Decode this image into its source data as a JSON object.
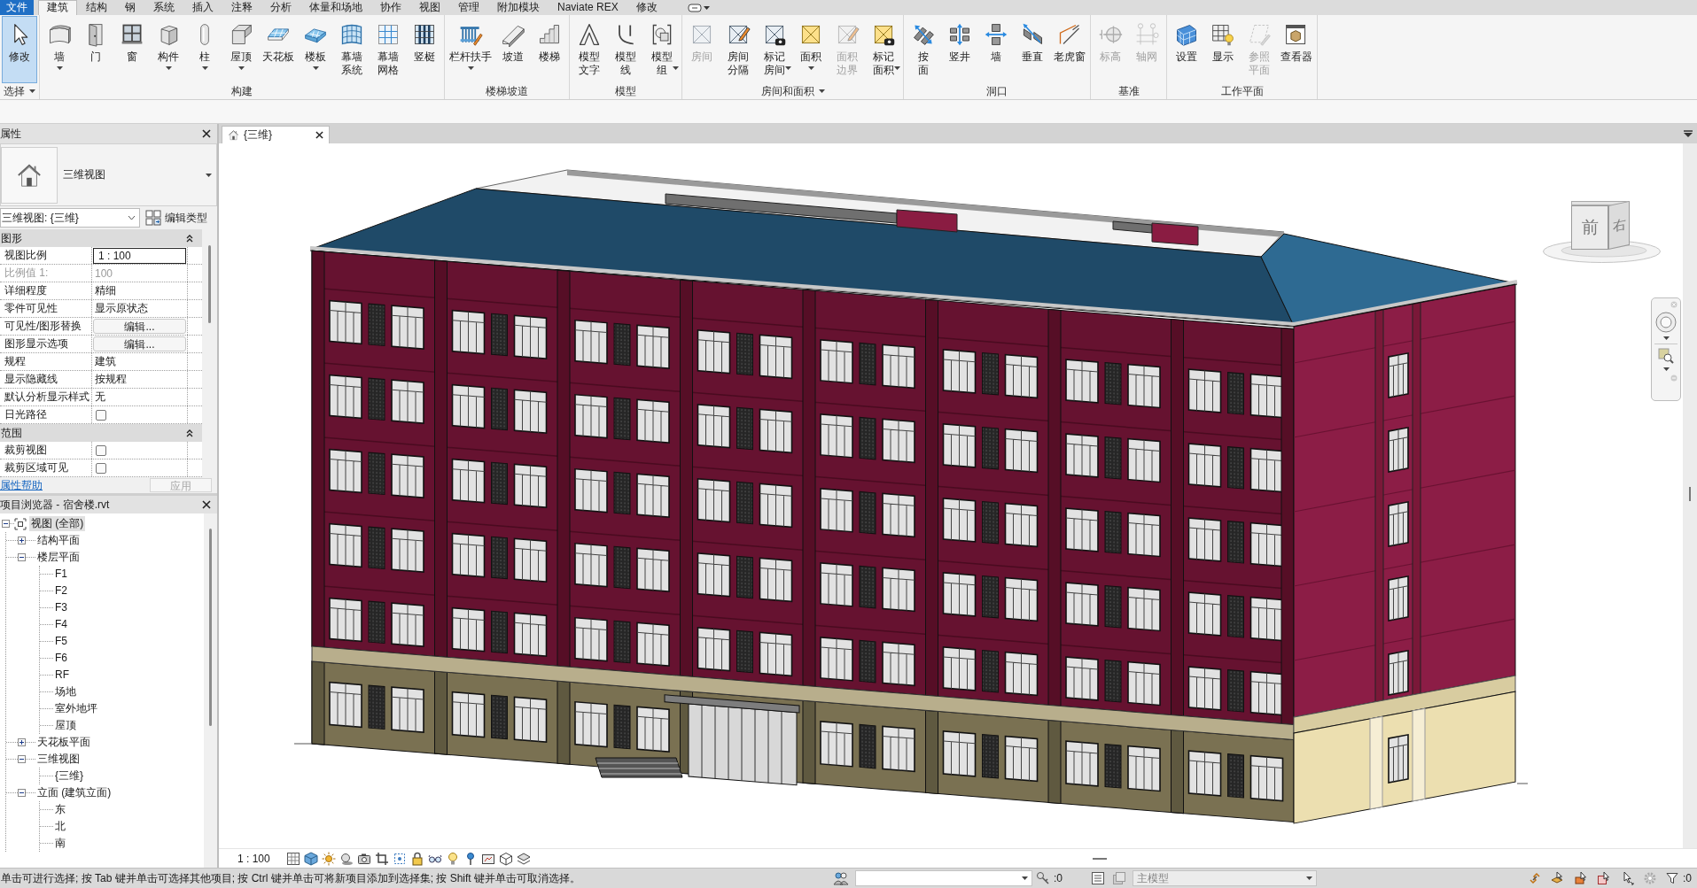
{
  "menu_tabs": [
    {
      "label": "文件",
      "kind": "file",
      "selected": false
    },
    {
      "label": "建筑",
      "kind": "tab",
      "selected": true
    },
    {
      "label": "结构",
      "kind": "tab",
      "selected": false
    },
    {
      "label": "钢",
      "kind": "tab",
      "selected": false
    },
    {
      "label": "系统",
      "kind": "tab",
      "selected": false
    },
    {
      "label": "插入",
      "kind": "tab",
      "selected": false
    },
    {
      "label": "注释",
      "kind": "tab",
      "selected": false
    },
    {
      "label": "分析",
      "kind": "tab",
      "selected": false
    },
    {
      "label": "体量和场地",
      "kind": "tab",
      "selected": false
    },
    {
      "label": "协作",
      "kind": "tab",
      "selected": false
    },
    {
      "label": "视图",
      "kind": "tab",
      "selected": false
    },
    {
      "label": "管理",
      "kind": "tab",
      "selected": false
    },
    {
      "label": "附加模块",
      "kind": "tab",
      "selected": false
    },
    {
      "label": "Naviate REX",
      "kind": "tab",
      "selected": false
    },
    {
      "label": "修改",
      "kind": "tab",
      "selected": false
    }
  ],
  "ribbon_panels": [
    {
      "title": "选择",
      "menu": true,
      "tools": [
        {
          "kind": "modify",
          "label": "修改",
          "active": true,
          "disabled": false,
          "dropdown": false,
          "two_line": false
        }
      ]
    },
    {
      "title": "构建",
      "menu": false,
      "tools": [
        {
          "kind": "wall",
          "label": "墙",
          "active": false,
          "disabled": false,
          "dropdown": true,
          "two_line": false
        },
        {
          "kind": "door",
          "label": "门",
          "active": false,
          "disabled": false,
          "dropdown": false
        },
        {
          "kind": "window",
          "label": "窗",
          "active": false,
          "disabled": false,
          "dropdown": false
        },
        {
          "kind": "component",
          "label": "构件",
          "active": false,
          "disabled": false,
          "dropdown": true,
          "two_line": false
        },
        {
          "kind": "column",
          "label": "柱",
          "active": false,
          "disabled": false,
          "dropdown": true,
          "two_line": false
        },
        {
          "kind": "roof",
          "label": "屋顶",
          "active": false,
          "disabled": false,
          "dropdown": true,
          "two_line": false
        },
        {
          "kind": "ceiling",
          "label": "天花板",
          "active": false,
          "disabled": false,
          "dropdown": false,
          "two_line": false
        },
        {
          "kind": "floor",
          "label": "楼板",
          "active": false,
          "disabled": false,
          "dropdown": true,
          "two_line": false
        },
        {
          "kind": "curtain_system",
          "label": "幕墙系统",
          "active": false,
          "disabled": false,
          "dropdown": false,
          "two_line": true
        },
        {
          "kind": "curtain_grid",
          "label": "幕墙网格",
          "active": false,
          "disabled": false,
          "dropdown": false,
          "two_line": true
        },
        {
          "kind": "mullion",
          "label": "竖梃",
          "active": false,
          "disabled": false,
          "dropdown": false,
          "two_line": false
        }
      ]
    },
    {
      "title": "楼梯坡道",
      "menu": false,
      "tools": [
        {
          "kind": "railing",
          "label": "栏杆扶手",
          "active": false,
          "disabled": false,
          "dropdown": true,
          "two_line": false
        },
        {
          "kind": "ramp",
          "label": "坡道",
          "active": false,
          "disabled": false,
          "dropdown": false,
          "two_line": false
        },
        {
          "kind": "stair",
          "label": "楼梯",
          "active": false,
          "disabled": false,
          "dropdown": false,
          "two_line": false
        }
      ]
    },
    {
      "title": "模型",
      "menu": false,
      "tools": [
        {
          "kind": "model_text",
          "label": "模型文字",
          "active": false,
          "disabled": false,
          "dropdown": false,
          "two_line": true
        },
        {
          "kind": "model_line",
          "label": "模型线",
          "active": false,
          "disabled": false,
          "dropdown": false,
          "two_line": true
        },
        {
          "kind": "model_group",
          "label": "模型组",
          "active": false,
          "disabled": false,
          "dropdown": true,
          "two_line": true
        }
      ]
    },
    {
      "title": "房间和面积",
      "menu": true,
      "tools": [
        {
          "kind": "room",
          "label": "房间",
          "active": false,
          "disabled": true,
          "dropdown": false,
          "two_line": false
        },
        {
          "kind": "room_separator",
          "label": "房间分隔",
          "active": false,
          "disabled": false,
          "dropdown": false,
          "two_line": true
        },
        {
          "kind": "room_tag",
          "label": "标记房间",
          "active": false,
          "disabled": false,
          "dropdown": true,
          "two_line": true
        },
        {
          "kind": "area",
          "label": "面积",
          "active": false,
          "disabled": false,
          "dropdown": true,
          "two_line": false
        },
        {
          "kind": "area_boundary",
          "label": "面积边界",
          "active": false,
          "disabled": true,
          "dropdown": false,
          "two_line": true
        },
        {
          "kind": "area_tag",
          "label": "标记面积",
          "active": false,
          "disabled": false,
          "dropdown": true,
          "two_line": true
        }
      ]
    },
    {
      "title": "洞口",
      "menu": false,
      "tools": [
        {
          "kind": "by_face",
          "label": "按面",
          "active": false,
          "disabled": false,
          "dropdown": false,
          "two_line": true
        },
        {
          "kind": "shaft",
          "label": "竖井",
          "active": false,
          "disabled": false,
          "dropdown": false,
          "two_line": false
        },
        {
          "kind": "wall_opening",
          "label": "墙",
          "active": false,
          "disabled": false,
          "dropdown": false
        },
        {
          "kind": "vertical",
          "label": "垂直",
          "active": false,
          "disabled": false,
          "dropdown": false,
          "two_line": false
        },
        {
          "kind": "dormer",
          "label": "老虎窗",
          "active": false,
          "disabled": false,
          "dropdown": false,
          "two_line": false
        }
      ]
    },
    {
      "title": "基准",
      "menu": false,
      "tools": [
        {
          "kind": "level",
          "label": "标高",
          "active": false,
          "disabled": true,
          "dropdown": false,
          "two_line": false
        },
        {
          "kind": "grid",
          "label": "轴网",
          "active": false,
          "disabled": true,
          "dropdown": false,
          "two_line": false
        }
      ]
    },
    {
      "title": "工作平面",
      "menu": false,
      "tools": [
        {
          "kind": "set_workplane",
          "label": "设置",
          "active": false,
          "disabled": false,
          "dropdown": false,
          "two_line": false
        },
        {
          "kind": "show_workplane",
          "label": "显示",
          "active": false,
          "disabled": false,
          "dropdown": false,
          "two_line": false
        },
        {
          "kind": "reference_plane",
          "label": "参照平面",
          "active": false,
          "disabled": true,
          "dropdown": false,
          "two_line": true
        },
        {
          "kind": "viewer",
          "label": "查看器",
          "active": false,
          "disabled": false,
          "dropdown": false,
          "two_line": false
        }
      ]
    }
  ],
  "properties": {
    "title": "属性",
    "type_name": "三维视图",
    "instance": "三维视图: {三维}",
    "edit_type": "编辑类型",
    "groups": [
      {
        "name": "图形",
        "expanded": true,
        "rows": [
          {
            "label": "视图比例",
            "kind": "input",
            "value": "1 : 100",
            "disabled": false
          },
          {
            "label": "比例值 1:",
            "kind": "text",
            "value": "100",
            "disabled": true
          },
          {
            "label": "详细程度",
            "kind": "text",
            "value": "精细",
            "disabled": false
          },
          {
            "label": "零件可见性",
            "kind": "text",
            "value": "显示原状态",
            "disabled": false
          },
          {
            "label": "可见性/图形替换",
            "kind": "button",
            "value": "编辑...",
            "disabled": false
          },
          {
            "label": "图形显示选项",
            "kind": "button",
            "value": "编辑...",
            "disabled": false
          },
          {
            "label": "规程",
            "kind": "text",
            "value": "建筑",
            "disabled": false
          },
          {
            "label": "显示隐藏线",
            "kind": "text",
            "value": "按规程",
            "disabled": false
          },
          {
            "label": "默认分析显示样式",
            "kind": "text",
            "value": "无",
            "disabled": false
          },
          {
            "label": "日光路径",
            "kind": "checkbox",
            "checked": false,
            "disabled": false
          }
        ]
      },
      {
        "name": "范围",
        "expanded": true,
        "rows": [
          {
            "label": "裁剪视图",
            "kind": "checkbox",
            "checked": false,
            "disabled": false
          },
          {
            "label": "裁剪区域可见",
            "kind": "checkbox",
            "checked": false,
            "disabled": false
          }
        ]
      }
    ],
    "help_link": "属性帮助",
    "apply_button": {
      "label": "应用",
      "disabled": true
    }
  },
  "project_browser": {
    "title": "项目浏览器 - 宿舍楼.rvt",
    "tree": [
      {
        "label": "视图 (全部)",
        "expanded": true,
        "selected": true,
        "children": [
          {
            "label": "结构平面",
            "expanded": false,
            "selected": false
          },
          {
            "label": "楼层平面",
            "expanded": true,
            "selected": false,
            "children": [
              {
                "label": "F1",
                "selected": false
              },
              {
                "label": "F2",
                "selected": false
              },
              {
                "label": "F3",
                "selected": false
              },
              {
                "label": "F4",
                "selected": false
              },
              {
                "label": "F5",
                "selected": false
              },
              {
                "label": "F6",
                "selected": false
              },
              {
                "label": "RF",
                "selected": false
              },
              {
                "label": "场地",
                "selected": false
              },
              {
                "label": "室外地坪",
                "selected": false
              },
              {
                "label": "屋顶",
                "selected": false
              }
            ]
          },
          {
            "label": "天花板平面",
            "expanded": false,
            "selected": false
          },
          {
            "label": "三维视图",
            "expanded": true,
            "selected": false,
            "children": [
              {
                "label": "{三维}",
                "selected": false
              }
            ]
          },
          {
            "label": "立面 (建筑立面)",
            "expanded": true,
            "selected": false,
            "children": [
              {
                "label": "东",
                "selected": false
              },
              {
                "label": "北",
                "selected": false
              },
              {
                "label": "南",
                "selected": false
              }
            ]
          }
        ]
      }
    ]
  },
  "view_tabs": [
    {
      "label": "{三维}",
      "selected": true
    }
  ],
  "view_cube": {
    "front": "前",
    "right": "右"
  },
  "view_control_bar": {
    "scale": "1 : 100"
  },
  "status_bar": {
    "message": "单击可进行选择; 按 Tab 键并单击可选择其他项目; 按 Ctrl 键并单击可将新项目添加到选择集; 按 Shift 键并单击可取消选择。",
    "count": ":0",
    "model_field": {
      "value": "主模型",
      "disabled": true
    },
    "filter_count": ":0"
  }
}
